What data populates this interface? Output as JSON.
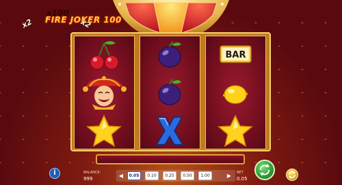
{
  "game": {
    "title": "FIRE JOKER 100"
  },
  "multiplier_wheel": {
    "left": "x2",
    "center": "x100",
    "right": "x2"
  },
  "reels": [
    [
      "cherries",
      "joker",
      "star"
    ],
    [
      "plum",
      "plum",
      "blue-x"
    ],
    [
      "bar",
      "lemon",
      "star"
    ]
  ],
  "symbols": {
    "bar_text": "BAR"
  },
  "message": "",
  "balance": {
    "label": "BALANCE:",
    "value": "999"
  },
  "bet": {
    "label": "BET",
    "value": "0.05",
    "options": [
      "0.05",
      "0.10",
      "0.25",
      "0.50",
      "1.00"
    ],
    "selected_index": 0
  },
  "buttons": {
    "info": "i",
    "prev": "◀",
    "next": "▶"
  },
  "colors": {
    "title": "#ffcf3a",
    "reel_bg": "#6e0d1d",
    "frame": "#f3c452",
    "spin": "#2f9e36",
    "autoplay": "#e0a91e"
  }
}
